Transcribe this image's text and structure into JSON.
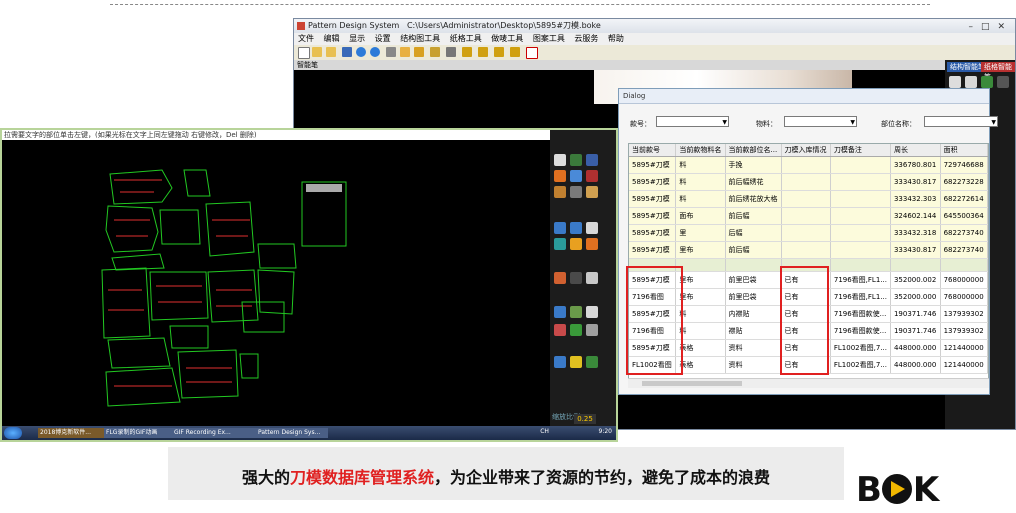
{
  "back_window": {
    "title": "Pattern Design System",
    "path": "C:\\Users\\Administrator\\Desktop\\5895#刀模.boke",
    "menu": [
      "文件",
      "编辑",
      "显示",
      "设置",
      "结构图工具",
      "纸格工具",
      "做唛工具",
      "图案工具",
      "云服务",
      "帮助"
    ],
    "subbar_label": "智能笔",
    "panel_tabs": [
      "结构智能笔",
      "纸格智能笔"
    ]
  },
  "cad_window": {
    "status_text": "拉需要文字的部位单击左键，(如果光标在文字上同左键拖动 右键修改，Del 删除)",
    "zoom_label": "缩放比例",
    "zoom_value": "0.25",
    "taskbar_items": [
      "2018博克新软件...",
      "FLG录制的GIF动画",
      "GIF Recording Ex...",
      "Pattern Design Sys..."
    ],
    "clock": "9:20",
    "lang": "CH"
  },
  "dialog": {
    "title": "Dialog",
    "filters": {
      "style_label": "款号：",
      "material_label": "物料：",
      "part_label": "部位名称："
    },
    "columns": [
      "当前款号",
      "当前款物料名",
      "当前款部位名...",
      "刀模入库情况",
      "刀模备注",
      "周长",
      "面积"
    ],
    "rows_top": [
      [
        "5895#刀模",
        "料",
        "手挽",
        "",
        "",
        "336780.801",
        "729746688"
      ],
      [
        "5895#刀模",
        "料",
        "前后幅绣花",
        "",
        "",
        "333430.817",
        "682273228"
      ],
      [
        "5895#刀模",
        "料",
        "前后绣花放大格",
        "",
        "",
        "333432.303",
        "682272614"
      ],
      [
        "5895#刀模",
        "面布",
        "前后幅",
        "",
        "",
        "324602.144",
        "645500364"
      ],
      [
        "5895#刀模",
        "里",
        "后幅",
        "",
        "",
        "333432.318",
        "682273740"
      ],
      [
        "5895#刀模",
        "里布",
        "前后幅",
        "",
        "",
        "333430.817",
        "682273740"
      ]
    ],
    "rows_bottom": [
      [
        "5895#刀模",
        "里布",
        "前里巴袋",
        "已有",
        "7196看图,FL1...",
        "352000.002",
        "768000000"
      ],
      [
        "7196看图",
        "里布",
        "前里巴袋",
        "已有",
        "7196看图,FL1...",
        "352000.000",
        "768000000"
      ],
      [
        "5895#刀模",
        "料",
        "内襟贴",
        "已有",
        "7196看图款使...",
        "190371.746",
        "137939302"
      ],
      [
        "7196看图",
        "料",
        "襟贴",
        "已有",
        "7196看图款使...",
        "190371.746",
        "137939302"
      ],
      [
        "5895#刀模",
        "表格",
        "资料",
        "已有",
        "FL1002看图,7...",
        "448000.000",
        "121440000"
      ],
      [
        "FL1002看图",
        "表格",
        "资料",
        "已有",
        "FL1002看图,7...",
        "448000.000",
        "121440000"
      ]
    ]
  },
  "caption": {
    "prefix": "强大的",
    "highlight": "刀模数据库管理系统",
    "suffix": "，为企业带来了资源的节约，避免了成本的浪费"
  },
  "logo": {
    "b": "B",
    "k": "K"
  },
  "colors": {
    "accent_red": "#e02020",
    "cad_line_green": "#22c822",
    "cad_line_red": "#e03030",
    "logo_yellow": "#f2b800"
  }
}
